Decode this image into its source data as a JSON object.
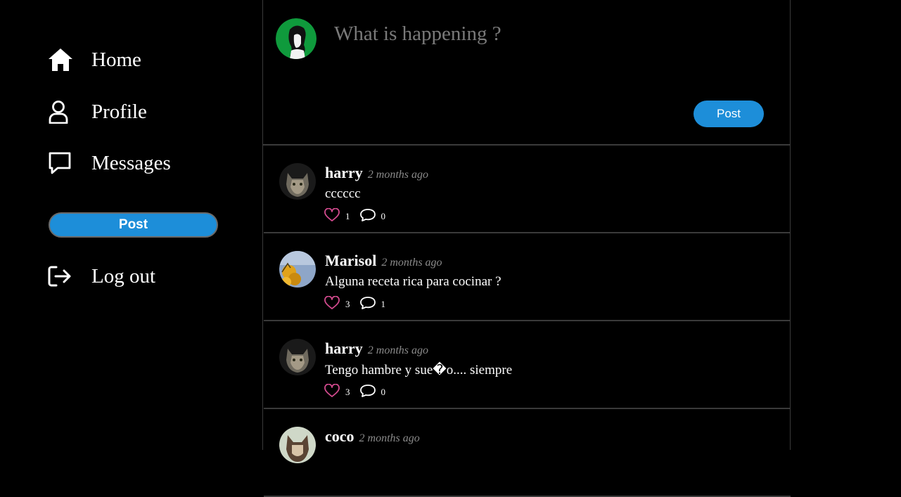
{
  "sidebar": {
    "items": [
      {
        "label": "Home",
        "icon": "home-icon"
      },
      {
        "label": "Profile",
        "icon": "user-icon"
      },
      {
        "label": "Messages",
        "icon": "message-icon"
      }
    ],
    "post_button": "Post",
    "logout": {
      "label": "Log out",
      "icon": "logout-icon"
    }
  },
  "composer": {
    "placeholder": "What is happening ?",
    "post_button": "Post"
  },
  "feed": {
    "posts": [
      {
        "user": "harry",
        "time": "2 months ago",
        "text": "cccccc",
        "likes": "1",
        "comments": "0"
      },
      {
        "user": "Marisol",
        "time": "2 months ago",
        "text": "Alguna receta rica para cocinar ?",
        "likes": "3",
        "comments": "1"
      },
      {
        "user": "harry",
        "time": "2 months ago",
        "text": "Tengo hambre y sue�o.... siempre",
        "likes": "3",
        "comments": "0"
      },
      {
        "user": "coco",
        "time": "2 months ago",
        "text": "",
        "likes": "",
        "comments": ""
      }
    ]
  },
  "colors": {
    "background": "#000000",
    "accent": "#1d8ed9",
    "like": "#d44b8f",
    "border": "#3a3a3a",
    "muted": "#8a8a8a"
  }
}
